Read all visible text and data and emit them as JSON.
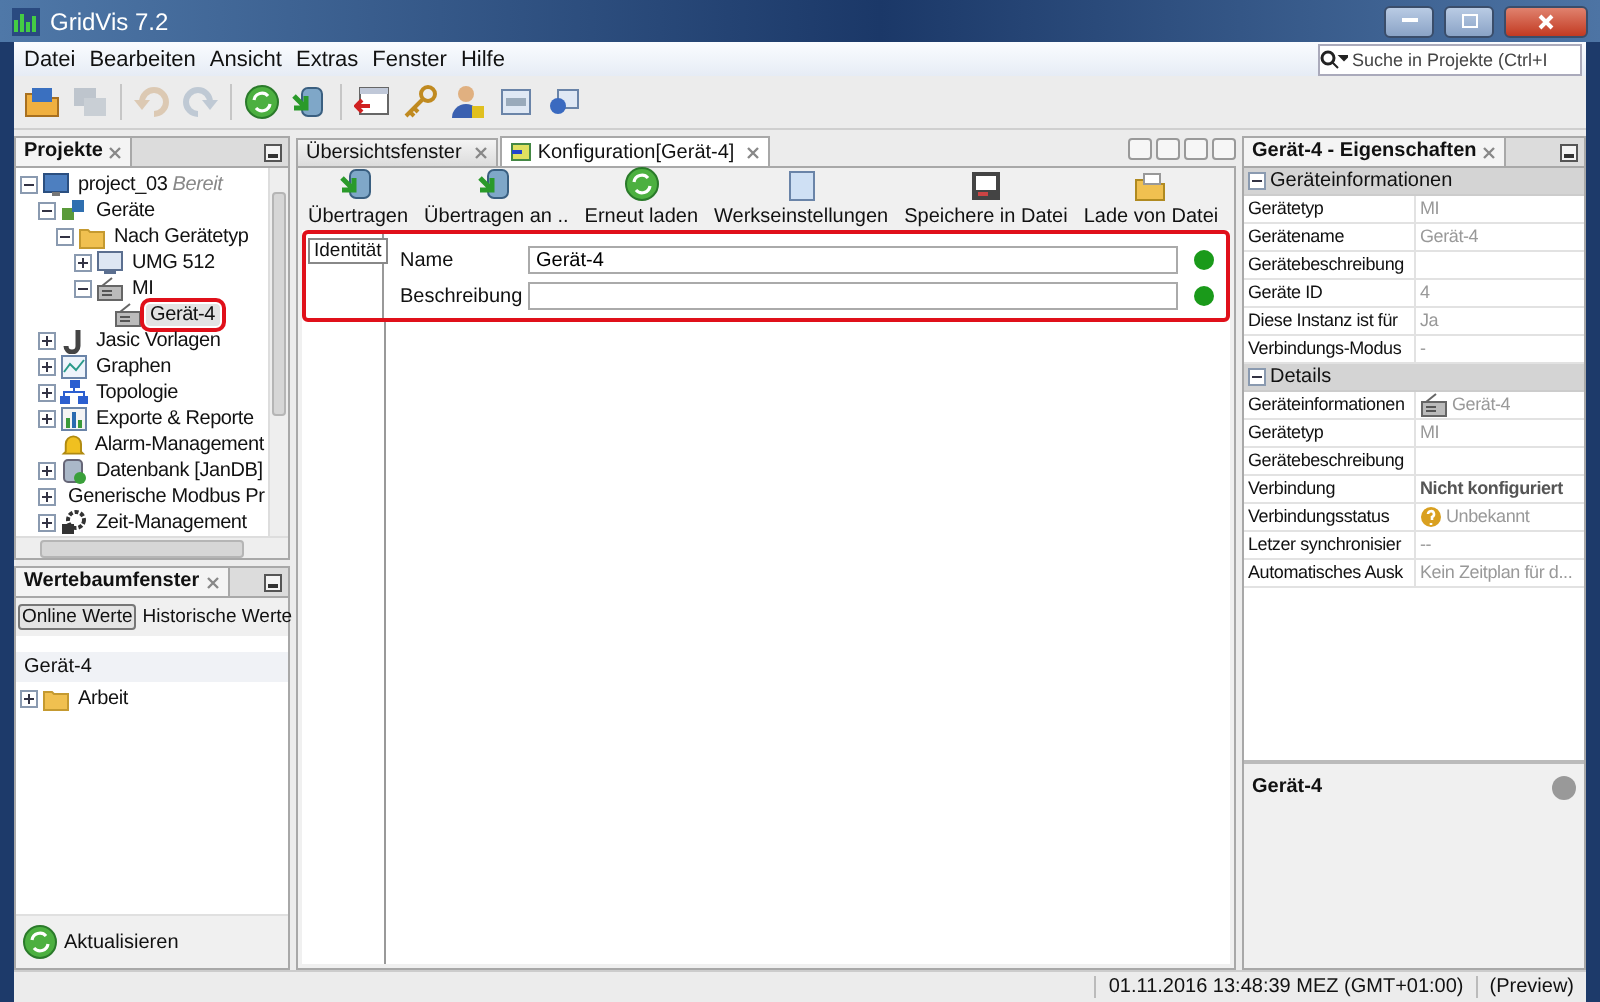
{
  "window": {
    "title": "GridVis 7.2"
  },
  "menu": [
    "Datei",
    "Bearbeiten",
    "Ansicht",
    "Extras",
    "Fenster",
    "Hilfe"
  ],
  "toolbar": [
    {
      "kind": "open",
      "disabled": false
    },
    {
      "kind": "windows",
      "disabled": true
    },
    {
      "kind": "undo",
      "disabled": true
    },
    {
      "kind": "redo",
      "disabled": true
    },
    {
      "kind": "refresh",
      "disabled": false
    },
    {
      "kind": "transfer",
      "disabled": false
    },
    {
      "kind": "import",
      "disabled": false
    },
    {
      "kind": "key",
      "disabled": false
    },
    {
      "kind": "user",
      "disabled": false
    },
    {
      "kind": "window",
      "disabled": false
    },
    {
      "kind": "network",
      "disabled": false
    }
  ],
  "search": {
    "placeholder": "Suche in Projekte (Ctrl+I"
  },
  "projects_panel": {
    "title": "Projekte",
    "tree": [
      {
        "label": "project_03",
        "status": "Bereit",
        "kind": "project",
        "expanded": true,
        "children": [
          {
            "label": "Geräte",
            "kind": "devices",
            "expanded": true,
            "children": [
              {
                "label": "Nach Gerätetyp",
                "kind": "folder",
                "expanded": true,
                "children": [
                  {
                    "label": "UMG 512",
                    "kind": "monitor",
                    "expanded": false
                  },
                  {
                    "label": "MI",
                    "kind": "meter",
                    "expanded": true,
                    "children": [
                      {
                        "label": "Gerät-4",
                        "kind": "meter",
                        "selected": true,
                        "highlighted": true
                      }
                    ]
                  }
                ]
              }
            ]
          },
          {
            "label": "Jasic Vorlagen",
            "kind": "script",
            "expanded": false
          },
          {
            "label": "Graphen",
            "kind": "graph",
            "expanded": false
          },
          {
            "label": "Topologie",
            "kind": "topology",
            "expanded": false
          },
          {
            "label": "Exporte & Reporte",
            "kind": "report",
            "expanded": false
          },
          {
            "label": "Alarm-Management",
            "kind": "alarm"
          },
          {
            "label": "Datenbank [JanDB]",
            "kind": "database",
            "expanded": false
          },
          {
            "label": "Generische Modbus Pr",
            "kind": "folder",
            "expanded": false
          },
          {
            "label": "Zeit-Management",
            "kind": "time",
            "expanded": false
          }
        ]
      }
    ]
  },
  "values_panel": {
    "title": "Wertebaumfenster",
    "tabs": [
      {
        "label": "Online Werte",
        "selected": true
      },
      {
        "label": "Historische Werte",
        "selected": false
      }
    ],
    "device": "Gerät-4",
    "tree": [
      {
        "label": "Arbeit",
        "kind": "folder",
        "expanded": false
      }
    ],
    "button": "Aktualisieren"
  },
  "editor": {
    "tabs": [
      {
        "label": "Übersichtsfenster",
        "selected": false
      },
      {
        "label": "Konfiguration[Gerät-4]",
        "selected": true
      }
    ],
    "actions": [
      {
        "label": "Übertragen",
        "kind": "transfer"
      },
      {
        "label": "Übertragen an ..",
        "kind": "transfer"
      },
      {
        "label": "Erneut laden",
        "kind": "refresh"
      },
      {
        "label": "Werkseinstellungen",
        "kind": "page"
      },
      {
        "label": "Speichere in Datei",
        "kind": "save"
      },
      {
        "label": "Lade von Datei",
        "kind": "load"
      }
    ],
    "side_tabs": [
      {
        "label": "Identität",
        "selected": true
      }
    ],
    "fields": [
      {
        "label": "Name",
        "value": "Gerät-4",
        "ok": true
      },
      {
        "label": "Beschreibung",
        "ok": true
      }
    ]
  },
  "properties": {
    "title": "Gerät-4 - Eigenschaften",
    "sections": [
      {
        "title": "Geräteinformationen",
        "expanded": true,
        "rows": [
          {
            "name": "Gerätetyp",
            "value": "MI",
            "kind": "text"
          },
          {
            "name": "Gerätename",
            "value": "Gerät-4",
            "kind": "text"
          },
          {
            "name": "Gerätebeschreibung",
            "kind": "text"
          },
          {
            "name": "Geräte ID",
            "value": "4",
            "kind": "text"
          },
          {
            "name": "Diese Instanz ist für",
            "value": "Ja",
            "kind": "text"
          },
          {
            "name": "Verbindungs-Modus",
            "value": "-",
            "kind": "text"
          }
        ]
      },
      {
        "title": "Details",
        "expanded": true,
        "rows": [
          {
            "name": "Geräteinformationen",
            "value": "Gerät-4",
            "kind": "device"
          },
          {
            "name": "Gerätetyp",
            "value": "MI",
            "kind": "text"
          },
          {
            "name": "Gerätebeschreibung",
            "kind": "text"
          },
          {
            "name": "Verbindung",
            "value": "Nicht konfiguriert",
            "kind": "bold"
          },
          {
            "name": "Verbindungsstatus",
            "value": "Unbekannt",
            "kind": "unknown"
          },
          {
            "name": "Letzer synchronisier",
            "value": "--",
            "kind": "text"
          },
          {
            "name": "Automatisches Ausk",
            "value": "Kein Zeitplan für d...",
            "kind": "text"
          }
        ]
      }
    ],
    "footer": "Gerät-4"
  },
  "status_bar": [
    "01.11.2016 13:48:39 MEZ (GMT+01:00)",
    "(Preview)"
  ]
}
